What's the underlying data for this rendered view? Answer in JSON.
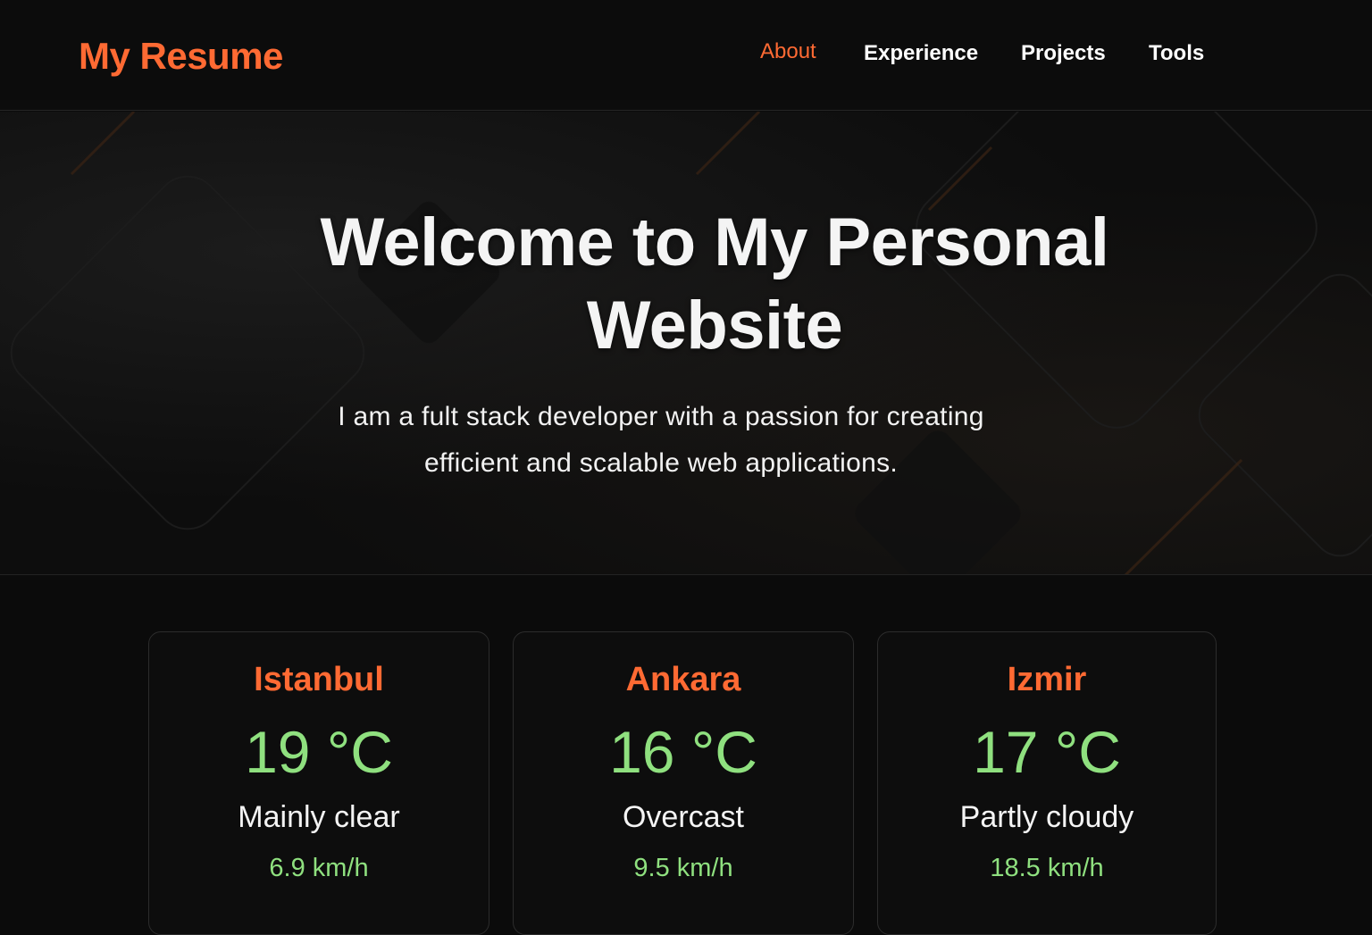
{
  "header": {
    "brand": "My Resume",
    "nav": [
      {
        "label": "About",
        "active": true
      },
      {
        "label": "Experience",
        "active": false
      },
      {
        "label": "Projects",
        "active": false
      },
      {
        "label": "Tools",
        "active": false
      }
    ]
  },
  "hero": {
    "title_line1": "Welcome to My Personal",
    "title_line2": "Website",
    "subtitle_line1": "I am a fult stack developer with a passion for creating",
    "subtitle_line2": "efficient and scalable web applications."
  },
  "weather": [
    {
      "city": "Istanbul",
      "temp": "19 °C",
      "condition": "Mainly clear",
      "wind": "6.9 km/h"
    },
    {
      "city": "Ankara",
      "temp": "16 °C",
      "condition": "Overcast",
      "wind": "9.5 km/h"
    },
    {
      "city": "Izmir",
      "temp": "17 °C",
      "condition": "Partly cloudy",
      "wind": "18.5 km/h"
    }
  ],
  "colors": {
    "accent": "#ff6a33",
    "temperature": "#8fe07f",
    "background": "#0b0b0b"
  }
}
